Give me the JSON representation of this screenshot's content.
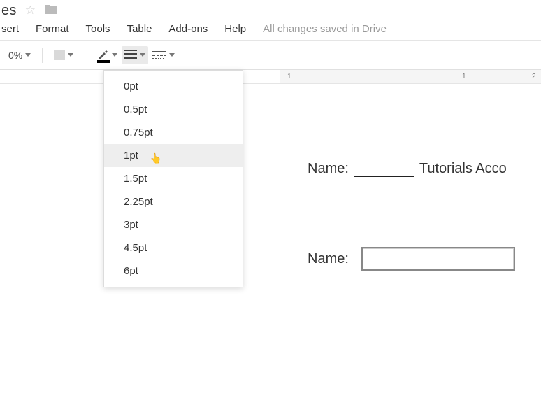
{
  "title": "es",
  "menu": {
    "items": [
      "sert",
      "Format",
      "Tools",
      "Table",
      "Add-ons",
      "Help"
    ],
    "status": "All changes saved in Drive"
  },
  "toolbar": {
    "zoom": "0%"
  },
  "ruler": {
    "marks": [
      "1",
      "1",
      "2"
    ]
  },
  "dropdown": {
    "items": [
      "0pt",
      "0.5pt",
      "0.75pt",
      "1pt",
      "1.5pt",
      "2.25pt",
      "3pt",
      "4.5pt",
      "6pt"
    ],
    "hoverIndex": 3
  },
  "document": {
    "label1": "Name:",
    "text1": "Tutorials Acco",
    "label2": "Name:"
  }
}
